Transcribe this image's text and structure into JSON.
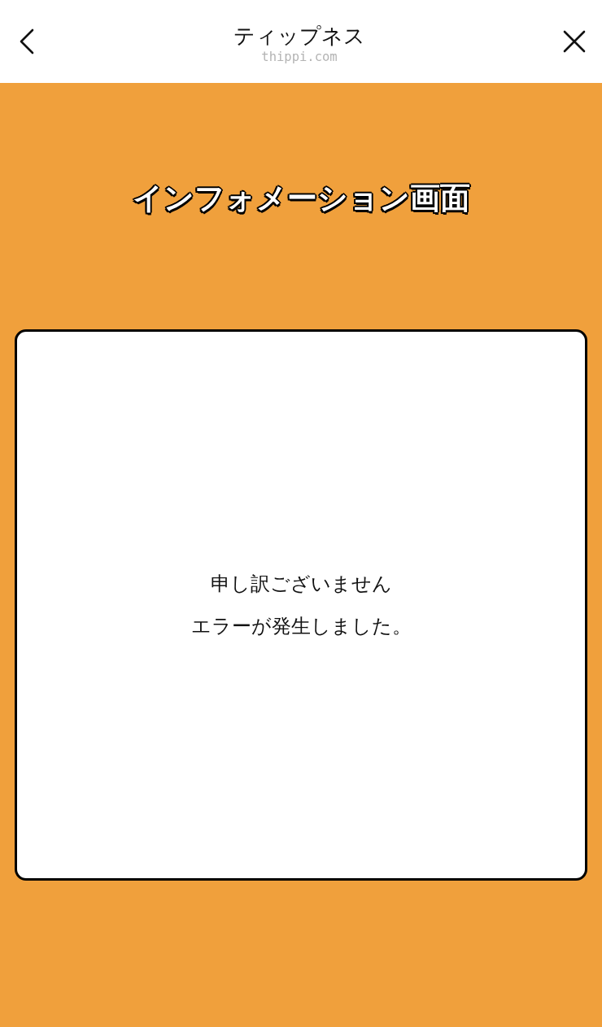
{
  "header": {
    "title": "ティップネス",
    "domain": "thippi.com"
  },
  "page": {
    "heading": "インフォメーション画面"
  },
  "message_card": {
    "lines": [
      "申し訳ございません",
      "エラーが発生しました。"
    ]
  }
}
